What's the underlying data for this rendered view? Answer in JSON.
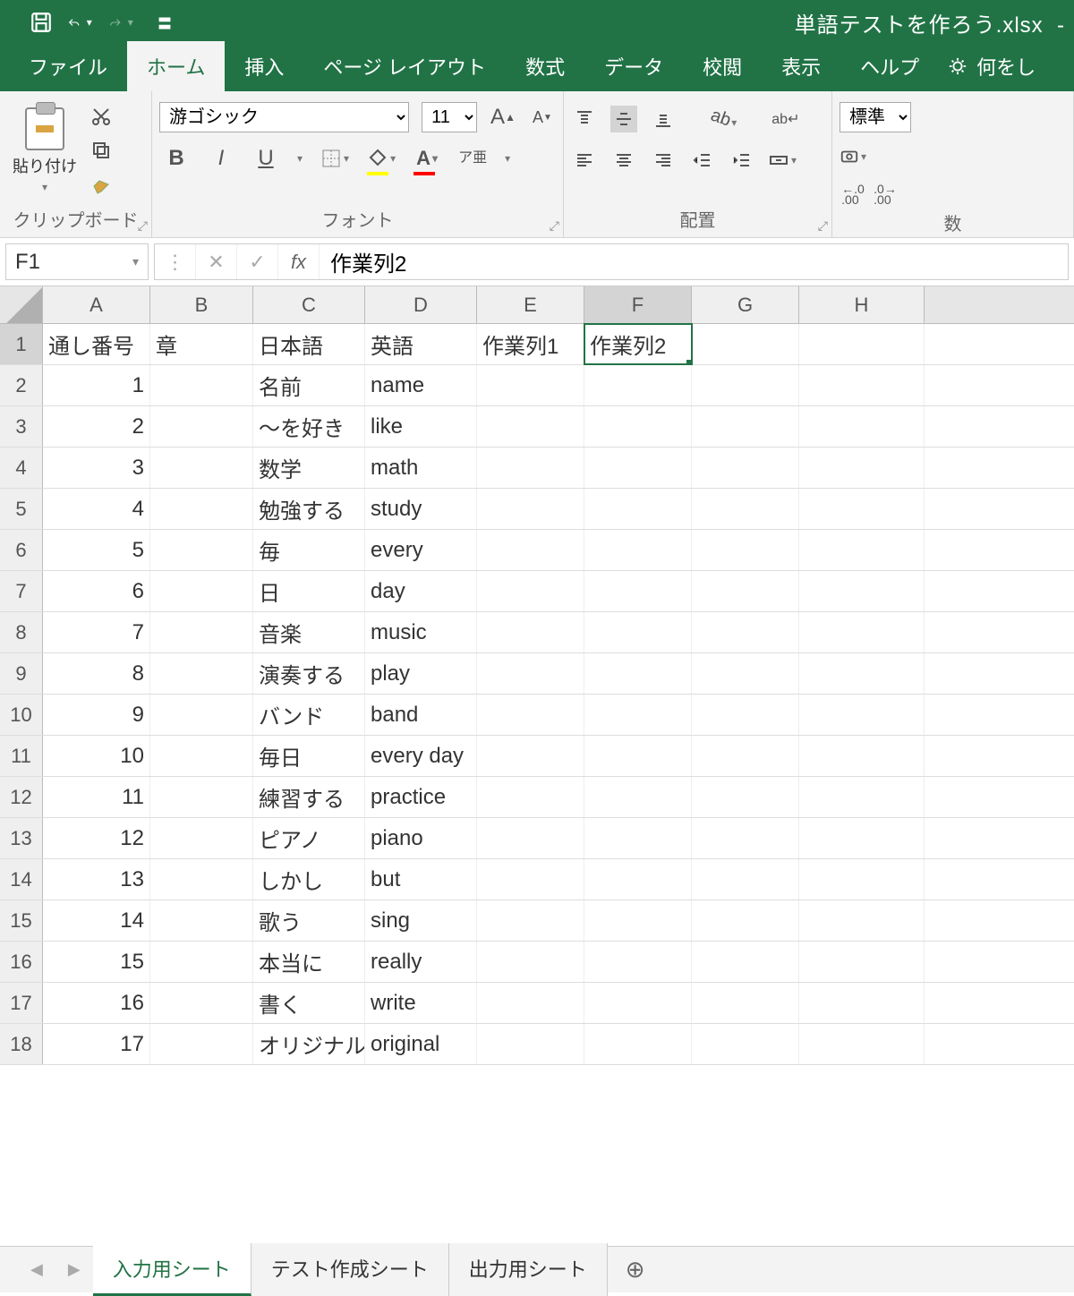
{
  "app": {
    "filename": "単語テストを作ろう.xlsx",
    "dash": "-"
  },
  "tabs": [
    "ファイル",
    "ホーム",
    "挿入",
    "ページ レイアウト",
    "数式",
    "データ",
    "校閲",
    "表示",
    "ヘルプ"
  ],
  "activeTab": 1,
  "tell": "何をし",
  "ribbon": {
    "clipboard": {
      "paste": "貼り付け",
      "label": "クリップボード"
    },
    "font": {
      "name": "游ゴシック",
      "size": "11",
      "label": "フォント",
      "bold": "B",
      "italic": "I",
      "underline": "U",
      "ruby": "ア亜"
    },
    "align": {
      "label": "配置",
      "wrap": "ab↵"
    },
    "number": {
      "label": "数",
      "format": "標準",
      "dec": "←.0\n.00",
      "inc": ".0→\n.00"
    }
  },
  "fbar": {
    "name": "F1",
    "value": "作業列2",
    "fx": "fx"
  },
  "columns": [
    "A",
    "B",
    "C",
    "D",
    "E",
    "F",
    "G",
    "H"
  ],
  "selectedCell": {
    "row": 0,
    "col": 5
  },
  "headerRow": [
    "通し番号",
    "章",
    "日本語",
    "英語",
    "作業列1",
    "作業列2"
  ],
  "dataRows": [
    {
      "n": "1",
      "jp": "名前",
      "en": "name"
    },
    {
      "n": "2",
      "jp": "～を好き",
      "en": "like"
    },
    {
      "n": "3",
      "jp": "数学",
      "en": "math"
    },
    {
      "n": "4",
      "jp": "勉強する",
      "en": "study"
    },
    {
      "n": "5",
      "jp": "毎",
      "en": "every"
    },
    {
      "n": "6",
      "jp": "日",
      "en": "day"
    },
    {
      "n": "7",
      "jp": "音楽",
      "en": "music"
    },
    {
      "n": "8",
      "jp": "演奏する",
      "en": "play"
    },
    {
      "n": "9",
      "jp": "バンド",
      "en": "band"
    },
    {
      "n": "10",
      "jp": "毎日",
      "en": "every day"
    },
    {
      "n": "11",
      "jp": "練習する",
      "en": "practice"
    },
    {
      "n": "12",
      "jp": "ピアノ",
      "en": "piano"
    },
    {
      "n": "13",
      "jp": "しかし",
      "en": "but"
    },
    {
      "n": "14",
      "jp": "歌う",
      "en": "sing"
    },
    {
      "n": "15",
      "jp": "本当に",
      "en": "really"
    },
    {
      "n": "16",
      "jp": "書く",
      "en": "write"
    },
    {
      "n": "17",
      "jp": "オリジナル",
      "en": "original"
    }
  ],
  "sheets": [
    "入力用シート",
    "テスト作成シート",
    "出力用シート"
  ],
  "activeSheet": 0
}
